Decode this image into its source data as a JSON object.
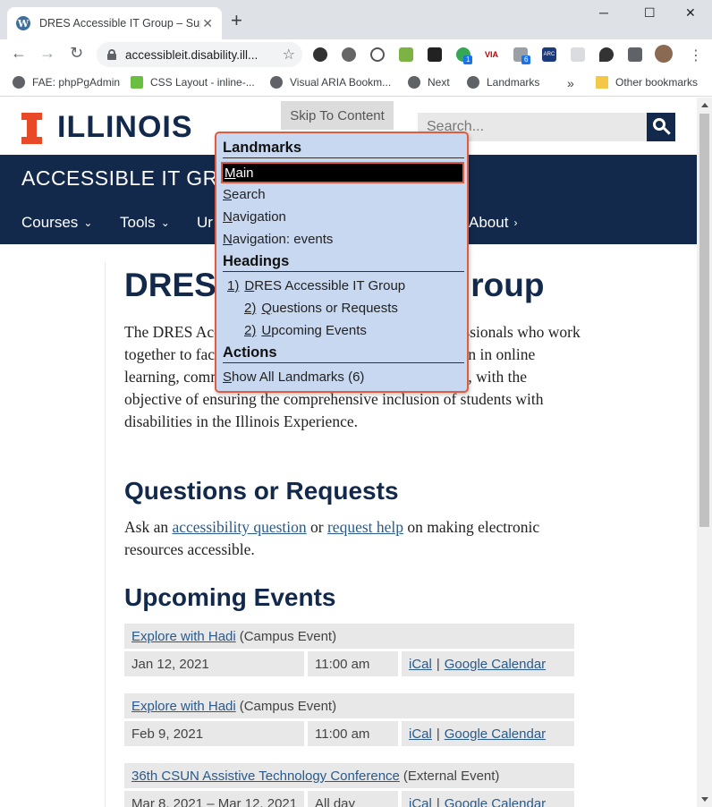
{
  "browser": {
    "tab_title": "DRES Accessible IT Group – Supp",
    "tab_favicon": "W",
    "url": "accessibleit.disability.ill...",
    "window_controls": {
      "minimize": "─",
      "maximize": "☐",
      "close": "✕"
    },
    "extension_badges": [
      "1",
      "6"
    ],
    "extension_labels": [
      "VIA",
      "ARC"
    ],
    "bookmarks": [
      {
        "label": "FAE: phpPgAdmin"
      },
      {
        "label": "CSS Layout - inline-..."
      },
      {
        "label": "Visual ARIA Bookm..."
      },
      {
        "label": "Next"
      },
      {
        "label": "Landmarks"
      }
    ],
    "bookmarks_overflow": "»",
    "other_bookmarks": "Other bookmarks"
  },
  "site": {
    "wordmark": "ILLINOIS",
    "skip_link": "Skip To Content",
    "search_placeholder": "Search...",
    "banner_title": "ACCESSIBLE IT GROUP",
    "nav": [
      {
        "label": "Courses",
        "chevron": "⌄"
      },
      {
        "label": "Tools",
        "chevron": "⌄"
      },
      {
        "label": "Ur",
        "chevron": ""
      },
      {
        "label": "About",
        "chevron": "›"
      }
    ]
  },
  "main": {
    "heading": "DRES Accessible IT Group",
    "intro": "The DRES Accessible IT Group is a group of IT professionals who work together to facilitate the application of accessible design in online learning, communication and information technologies, with the objective of ensuring the comprehensive inclusion of students with disabilities in the Illinois Experience.",
    "questions_heading": "Questions or Requests",
    "questions_text_1": "Ask an ",
    "questions_link_1": "accessibility question",
    "questions_text_2": " or ",
    "questions_link_2": "request help",
    "questions_text_3": " on making electronic resources accessible.",
    "events_heading": "Upcoming Events",
    "events": [
      {
        "title": "Explore with Hadi",
        "type": "(Campus Event)",
        "date": "Jan 12, 2021",
        "time": "11:00 am",
        "ical": "iCal",
        "sep": "|",
        "gcal": "Google Calendar"
      },
      {
        "title": "Explore with Hadi",
        "type": "(Campus Event)",
        "date": "Feb 9, 2021",
        "time": "11:00 am",
        "ical": "iCal",
        "sep": "|",
        "gcal": "Google Calendar"
      },
      {
        "title": "36th CSUN Assistive Technology Conference",
        "type": "(External Event)",
        "date": "Mar 8, 2021 – Mar 12, 2021",
        "time": "All day",
        "ical": "iCal",
        "sep": "|",
        "gcal": "Google Calendar"
      }
    ]
  },
  "popup": {
    "landmarks_heading": "Landmarks",
    "landmarks": [
      {
        "key": "M",
        "rest": "ain",
        "selected": true
      },
      {
        "key": "S",
        "rest": "earch",
        "selected": false
      },
      {
        "key": "N",
        "rest": "avigation",
        "selected": false
      },
      {
        "key": "N",
        "rest": "avigation: events",
        "selected": false
      }
    ],
    "headings_heading": "Headings",
    "headings": [
      {
        "level": "1)",
        "key": "D",
        "rest": "RES Accessible IT Group"
      },
      {
        "level": "2)",
        "key": "Q",
        "rest": "uestions or Requests"
      },
      {
        "level": "2)",
        "key": "U",
        "rest": "pcoming Events"
      }
    ],
    "actions_heading": "Actions",
    "actions": [
      {
        "key": "S",
        "rest": "how All Landmarks (6)"
      }
    ]
  }
}
